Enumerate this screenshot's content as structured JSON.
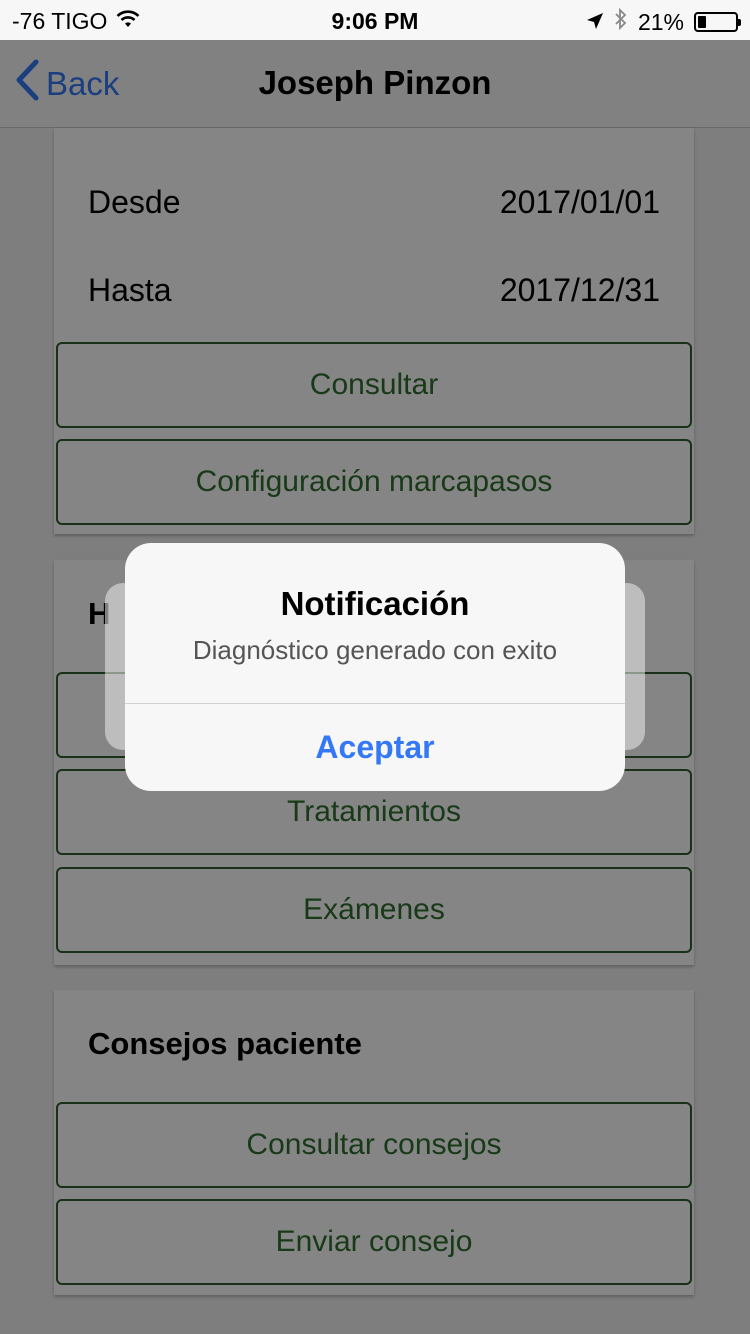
{
  "status_bar": {
    "carrier": "-76 TIGO",
    "time": "9:06 PM",
    "battery_text": "21%",
    "battery_level": 0.21,
    "icons": [
      "wifi-icon",
      "location-arrow-icon",
      "bluetooth-icon",
      "battery-icon"
    ]
  },
  "nav": {
    "back_label": "Back",
    "title": "Joseph Pinzon"
  },
  "date_card": {
    "from_label": "Desde",
    "from_value": "2017/01/01",
    "to_label": "Hasta",
    "to_value": "2017/12/31",
    "consult_button": "Consultar",
    "pacemaker_button": "Configuración marcapasos"
  },
  "history_card": {
    "title_partial": "H",
    "hidden_button": "",
    "treatments_button": "Tratamientos",
    "exams_button": "Exámenes"
  },
  "advice_card": {
    "title": "Consejos paciente",
    "consult_button": "Consultar consejos",
    "send_button": "Enviar consejo"
  },
  "alert": {
    "title": "Notificación",
    "message": "Diagnóstico generado con exito",
    "button": "Aceptar"
  },
  "colors": {
    "ios_blue": "#3478f6",
    "button_border": "#2f5f2f",
    "button_text": "#2f6f2f"
  }
}
